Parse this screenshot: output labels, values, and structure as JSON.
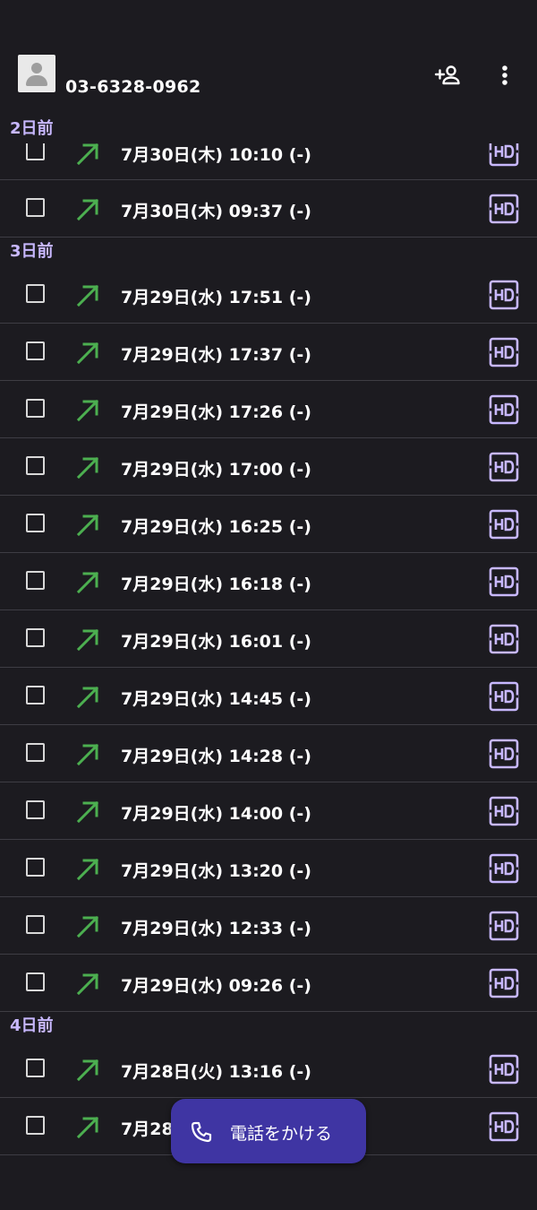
{
  "header": {
    "phone_number": "03-6328-0962",
    "avatar_icon": "person-icon",
    "add_contact_icon": "person-add-icon",
    "more_icon": "more-vert-icon"
  },
  "colors": {
    "background": "#1c1b20",
    "section_header": "#c8b8ff",
    "outgoing_arrow": "#4caf50",
    "hd_badge": "#c8b8ff",
    "fab": "#3f35a3"
  },
  "sections": [
    {
      "label": "2日前",
      "calls": [
        {
          "text": "7月30日(木) 10:10 (-)"
        },
        {
          "text": "7月30日(木) 09:37 (-)"
        }
      ]
    },
    {
      "label": "3日前",
      "calls": [
        {
          "text": "7月29日(水) 17:51 (-)"
        },
        {
          "text": "7月29日(水) 17:37 (-)"
        },
        {
          "text": "7月29日(水) 17:26 (-)"
        },
        {
          "text": "7月29日(水) 17:00 (-)"
        },
        {
          "text": "7月29日(水) 16:25 (-)"
        },
        {
          "text": "7月29日(水) 16:18 (-)"
        },
        {
          "text": "7月29日(水) 16:01 (-)"
        },
        {
          "text": "7月29日(水) 14:45 (-)"
        },
        {
          "text": "7月29日(水) 14:28 (-)"
        },
        {
          "text": "7月29日(水) 14:00 (-)"
        },
        {
          "text": "7月29日(水) 13:20 (-)"
        },
        {
          "text": "7月29日(水) 12:33 (-)"
        },
        {
          "text": "7月29日(水) 09:26 (-)"
        }
      ]
    },
    {
      "label": "4日前",
      "calls": [
        {
          "text": "7月28日(火) 13:16 (-)"
        },
        {
          "text": "7月28"
        }
      ]
    }
  ],
  "fab": {
    "label": "電話をかける",
    "icon": "phone-icon"
  }
}
